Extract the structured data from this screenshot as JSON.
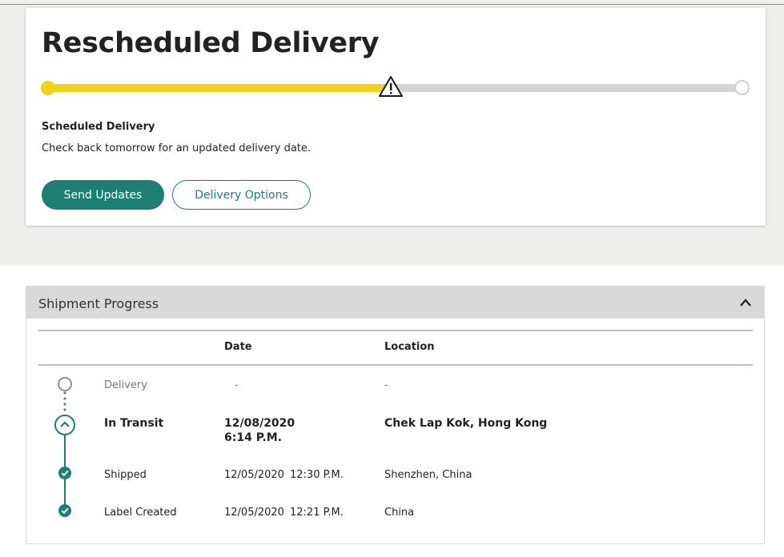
{
  "status": {
    "title": "Rescheduled Delivery",
    "progress": 0.5,
    "milestone_icon": "warning-triangle-icon",
    "scheduled_label": "Scheduled Delivery",
    "scheduled_text": "Check back tomorrow for an updated delivery date.",
    "send_updates_label": "Send Updates",
    "delivery_options_label": "Delivery Options"
  },
  "shipment": {
    "title": "Shipment Progress",
    "toggle_icon": "chevron-up-icon",
    "columns": {
      "date": "Date",
      "location": "Location"
    },
    "events": [
      {
        "status": "Delivery",
        "date": "-",
        "time": "",
        "location": "-",
        "state": "pending",
        "icon": "empty-circle-icon"
      },
      {
        "status": "In Transit",
        "date": "12/08/2020",
        "time": "6:14 P.M.",
        "location": "Chek Lap Kok, Hong Kong",
        "state": "current",
        "icon": "chevron-up-circle-icon"
      },
      {
        "status": "Shipped",
        "date": "12/05/2020",
        "time": "12:30 P.M.",
        "location": "Shenzhen, China",
        "state": "done",
        "icon": "check-circle-icon"
      },
      {
        "status": "Label Created",
        "date": "12/05/2020",
        "time": "12:21 P.M.",
        "location": "China",
        "state": "done",
        "icon": "check-circle-icon"
      }
    ]
  },
  "colors": {
    "accent": "#1d7f73",
    "progress": "#f2d31a",
    "track": "#d5d5d5",
    "band": "#efefed"
  }
}
